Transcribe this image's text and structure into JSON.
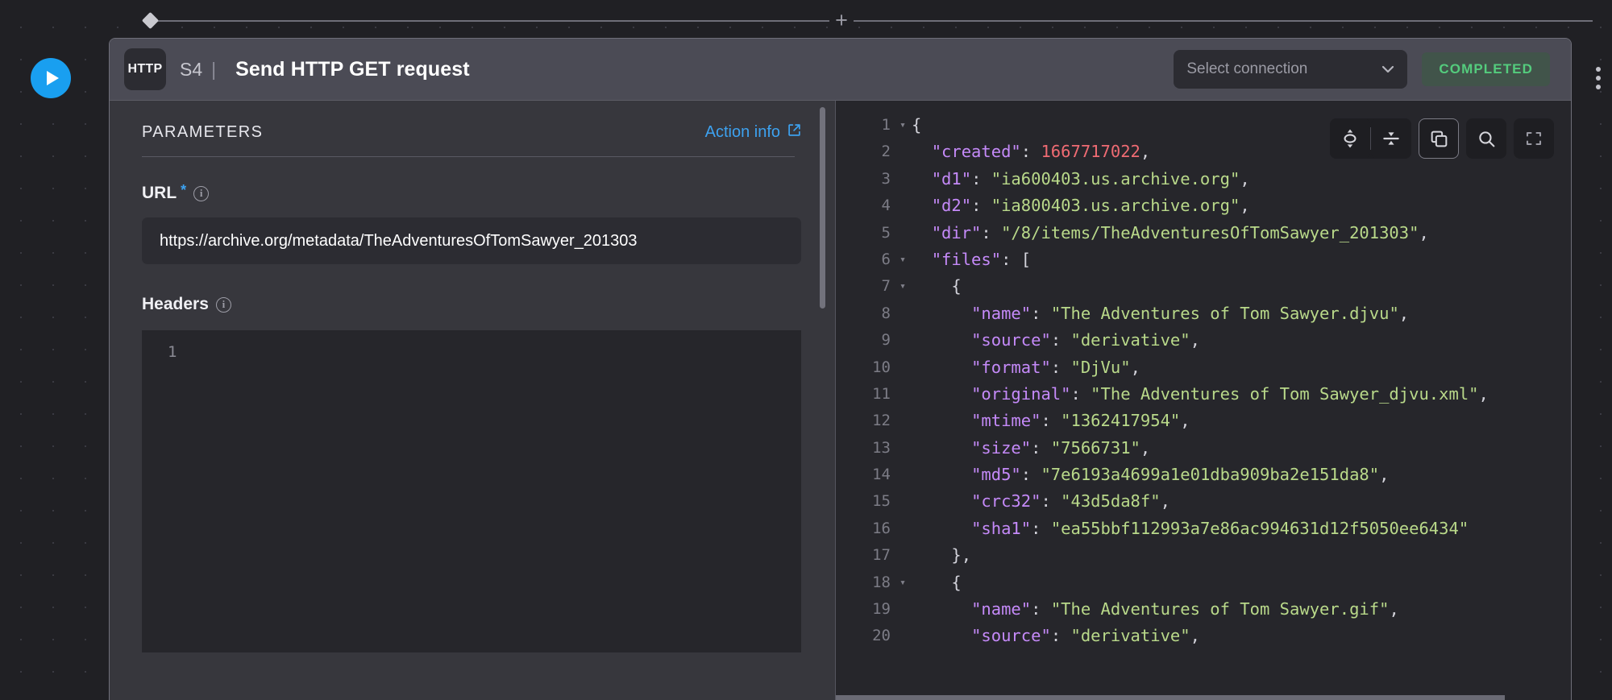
{
  "canvas": {
    "add_node_label": "+",
    "play_label": "play-triangle",
    "kebab_label": "more-options"
  },
  "node": {
    "type_badge": "HTTP",
    "step": "S4",
    "separator": "|",
    "title": "Send HTTP GET request",
    "connection": {
      "value": "Select connection",
      "chevron": "⌄"
    },
    "status": "COMPLETED",
    "status_color": "#54cc7d"
  },
  "parameters": {
    "heading": "PARAMETERS",
    "action_info_label": "Action info",
    "action_info_icon": "external-link-icon",
    "url": {
      "label": "URL",
      "required_marker": "*",
      "info_icon": "i",
      "value": "https://archive.org/metadata/TheAdventuresOfTomSawyer_201303",
      "placeholder": ""
    },
    "headers": {
      "label": "Headers",
      "info_icon": "i",
      "line_numbers": [
        "1"
      ],
      "value": ""
    }
  },
  "response": {
    "toolbar": [
      {
        "name": "expand-all-icon",
        "active": false
      },
      {
        "name": "collapse-all-icon",
        "active": false
      },
      {
        "name": "copy-icon",
        "active": true
      },
      {
        "name": "search-icon",
        "active": false
      },
      {
        "name": "fullscreen-icon",
        "active": false
      }
    ],
    "lines": [
      {
        "num": "1",
        "fold": "▾",
        "tokens": [
          {
            "t": "p",
            "v": "{"
          }
        ]
      },
      {
        "num": "2",
        "fold": "",
        "tokens": [
          {
            "t": "p",
            "v": "  "
          },
          {
            "t": "k",
            "v": "\"created\""
          },
          {
            "t": "p",
            "v": ": "
          },
          {
            "t": "n",
            "v": "1667717022"
          },
          {
            "t": "p",
            "v": ","
          }
        ]
      },
      {
        "num": "3",
        "fold": "",
        "tokens": [
          {
            "t": "p",
            "v": "  "
          },
          {
            "t": "k",
            "v": "\"d1\""
          },
          {
            "t": "p",
            "v": ": "
          },
          {
            "t": "s",
            "v": "\"ia600403.us.archive.org\""
          },
          {
            "t": "p",
            "v": ","
          }
        ]
      },
      {
        "num": "4",
        "fold": "",
        "tokens": [
          {
            "t": "p",
            "v": "  "
          },
          {
            "t": "k",
            "v": "\"d2\""
          },
          {
            "t": "p",
            "v": ": "
          },
          {
            "t": "s",
            "v": "\"ia800403.us.archive.org\""
          },
          {
            "t": "p",
            "v": ","
          }
        ]
      },
      {
        "num": "5",
        "fold": "",
        "tokens": [
          {
            "t": "p",
            "v": "  "
          },
          {
            "t": "k",
            "v": "\"dir\""
          },
          {
            "t": "p",
            "v": ": "
          },
          {
            "t": "s",
            "v": "\"/8/items/TheAdventuresOfTomSawyer_201303\""
          },
          {
            "t": "p",
            "v": ","
          }
        ]
      },
      {
        "num": "6",
        "fold": "▾",
        "tokens": [
          {
            "t": "p",
            "v": "  "
          },
          {
            "t": "k",
            "v": "\"files\""
          },
          {
            "t": "p",
            "v": ": ["
          }
        ]
      },
      {
        "num": "7",
        "fold": "▾",
        "tokens": [
          {
            "t": "p",
            "v": "    {"
          }
        ]
      },
      {
        "num": "8",
        "fold": "",
        "tokens": [
          {
            "t": "p",
            "v": "      "
          },
          {
            "t": "k",
            "v": "\"name\""
          },
          {
            "t": "p",
            "v": ": "
          },
          {
            "t": "s",
            "v": "\"The Adventures of Tom Sawyer.djvu\""
          },
          {
            "t": "p",
            "v": ","
          }
        ]
      },
      {
        "num": "9",
        "fold": "",
        "tokens": [
          {
            "t": "p",
            "v": "      "
          },
          {
            "t": "k",
            "v": "\"source\""
          },
          {
            "t": "p",
            "v": ": "
          },
          {
            "t": "s",
            "v": "\"derivative\""
          },
          {
            "t": "p",
            "v": ","
          }
        ]
      },
      {
        "num": "10",
        "fold": "",
        "tokens": [
          {
            "t": "p",
            "v": "      "
          },
          {
            "t": "k",
            "v": "\"format\""
          },
          {
            "t": "p",
            "v": ": "
          },
          {
            "t": "s",
            "v": "\"DjVu\""
          },
          {
            "t": "p",
            "v": ","
          }
        ]
      },
      {
        "num": "11",
        "fold": "",
        "tokens": [
          {
            "t": "p",
            "v": "      "
          },
          {
            "t": "k",
            "v": "\"original\""
          },
          {
            "t": "p",
            "v": ": "
          },
          {
            "t": "s",
            "v": "\"The Adventures of Tom Sawyer_djvu.xml\""
          },
          {
            "t": "p",
            "v": ","
          }
        ]
      },
      {
        "num": "12",
        "fold": "",
        "tokens": [
          {
            "t": "p",
            "v": "      "
          },
          {
            "t": "k",
            "v": "\"mtime\""
          },
          {
            "t": "p",
            "v": ": "
          },
          {
            "t": "s",
            "v": "\"1362417954\""
          },
          {
            "t": "p",
            "v": ","
          }
        ]
      },
      {
        "num": "13",
        "fold": "",
        "tokens": [
          {
            "t": "p",
            "v": "      "
          },
          {
            "t": "k",
            "v": "\"size\""
          },
          {
            "t": "p",
            "v": ": "
          },
          {
            "t": "s",
            "v": "\"7566731\""
          },
          {
            "t": "p",
            "v": ","
          }
        ]
      },
      {
        "num": "14",
        "fold": "",
        "tokens": [
          {
            "t": "p",
            "v": "      "
          },
          {
            "t": "k",
            "v": "\"md5\""
          },
          {
            "t": "p",
            "v": ": "
          },
          {
            "t": "s",
            "v": "\"7e6193a4699a1e01dba909ba2e151da8\""
          },
          {
            "t": "p",
            "v": ","
          }
        ]
      },
      {
        "num": "15",
        "fold": "",
        "tokens": [
          {
            "t": "p",
            "v": "      "
          },
          {
            "t": "k",
            "v": "\"crc32\""
          },
          {
            "t": "p",
            "v": ": "
          },
          {
            "t": "s",
            "v": "\"43d5da8f\""
          },
          {
            "t": "p",
            "v": ","
          }
        ]
      },
      {
        "num": "16",
        "fold": "",
        "tokens": [
          {
            "t": "p",
            "v": "      "
          },
          {
            "t": "k",
            "v": "\"sha1\""
          },
          {
            "t": "p",
            "v": ": "
          },
          {
            "t": "s",
            "v": "\"ea55bbf112993a7e86ac994631d12f5050ee6434\""
          }
        ]
      },
      {
        "num": "17",
        "fold": "",
        "tokens": [
          {
            "t": "p",
            "v": "    },"
          }
        ]
      },
      {
        "num": "18",
        "fold": "▾",
        "tokens": [
          {
            "t": "p",
            "v": "    {"
          }
        ]
      },
      {
        "num": "19",
        "fold": "",
        "tokens": [
          {
            "t": "p",
            "v": "      "
          },
          {
            "t": "k",
            "v": "\"name\""
          },
          {
            "t": "p",
            "v": ": "
          },
          {
            "t": "s",
            "v": "\"The Adventures of Tom Sawyer.gif\""
          },
          {
            "t": "p",
            "v": ","
          }
        ]
      },
      {
        "num": "20",
        "fold": "",
        "tokens": [
          {
            "t": "p",
            "v": "      "
          },
          {
            "t": "k",
            "v": "\"source\""
          },
          {
            "t": "p",
            "v": ": "
          },
          {
            "t": "s",
            "v": "\"derivative\""
          },
          {
            "t": "p",
            "v": ","
          }
        ]
      }
    ]
  }
}
